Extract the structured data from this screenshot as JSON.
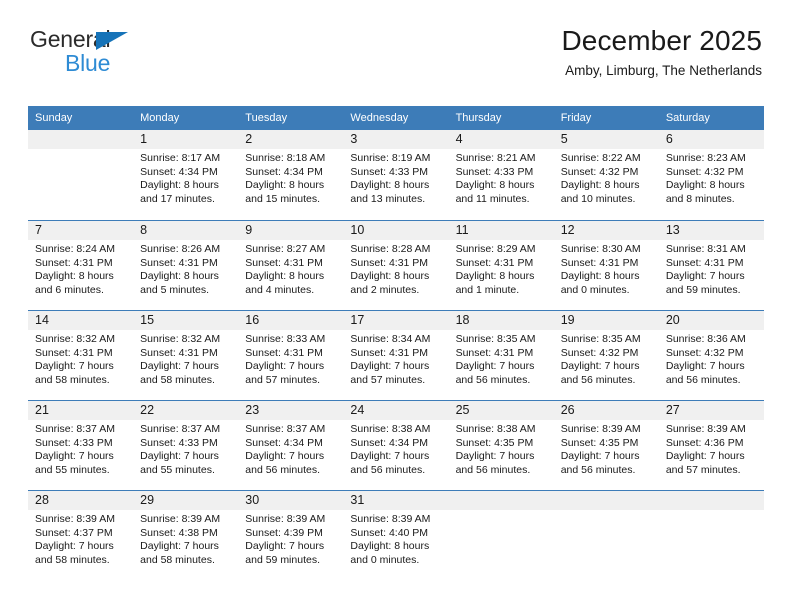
{
  "brand": {
    "line1": "General",
    "line2": "Blue",
    "triangle_icon": "triangle-icon",
    "color_dark": "#2b2b2b",
    "color_blue": "#2e8bd4",
    "color_triangle": "#1673b8"
  },
  "header": {
    "title": "December 2025",
    "subtitle": "Amby, Limburg, The Netherlands"
  },
  "theme": {
    "header_blue": "#3d7cb8",
    "row_divider": "#3d7cb8",
    "day_band": "#f0f0f0",
    "text": "#1a1a1a"
  },
  "weekdays": [
    "Sunday",
    "Monday",
    "Tuesday",
    "Wednesday",
    "Thursday",
    "Friday",
    "Saturday"
  ],
  "weeks": [
    [
      {
        "day": "",
        "empty": true,
        "sunrise": "",
        "sunset": "",
        "daylight1": "",
        "daylight2": ""
      },
      {
        "day": "1",
        "empty": false,
        "sunrise": "Sunrise: 8:17 AM",
        "sunset": "Sunset: 4:34 PM",
        "daylight1": "Daylight: 8 hours",
        "daylight2": "and 17 minutes."
      },
      {
        "day": "2",
        "empty": false,
        "sunrise": "Sunrise: 8:18 AM",
        "sunset": "Sunset: 4:34 PM",
        "daylight1": "Daylight: 8 hours",
        "daylight2": "and 15 minutes."
      },
      {
        "day": "3",
        "empty": false,
        "sunrise": "Sunrise: 8:19 AM",
        "sunset": "Sunset: 4:33 PM",
        "daylight1": "Daylight: 8 hours",
        "daylight2": "and 13 minutes."
      },
      {
        "day": "4",
        "empty": false,
        "sunrise": "Sunrise: 8:21 AM",
        "sunset": "Sunset: 4:33 PM",
        "daylight1": "Daylight: 8 hours",
        "daylight2": "and 11 minutes."
      },
      {
        "day": "5",
        "empty": false,
        "sunrise": "Sunrise: 8:22 AM",
        "sunset": "Sunset: 4:32 PM",
        "daylight1": "Daylight: 8 hours",
        "daylight2": "and 10 minutes."
      },
      {
        "day": "6",
        "empty": false,
        "sunrise": "Sunrise: 8:23 AM",
        "sunset": "Sunset: 4:32 PM",
        "daylight1": "Daylight: 8 hours",
        "daylight2": "and 8 minutes."
      }
    ],
    [
      {
        "day": "7",
        "empty": false,
        "sunrise": "Sunrise: 8:24 AM",
        "sunset": "Sunset: 4:31 PM",
        "daylight1": "Daylight: 8 hours",
        "daylight2": "and 6 minutes."
      },
      {
        "day": "8",
        "empty": false,
        "sunrise": "Sunrise: 8:26 AM",
        "sunset": "Sunset: 4:31 PM",
        "daylight1": "Daylight: 8 hours",
        "daylight2": "and 5 minutes."
      },
      {
        "day": "9",
        "empty": false,
        "sunrise": "Sunrise: 8:27 AM",
        "sunset": "Sunset: 4:31 PM",
        "daylight1": "Daylight: 8 hours",
        "daylight2": "and 4 minutes."
      },
      {
        "day": "10",
        "empty": false,
        "sunrise": "Sunrise: 8:28 AM",
        "sunset": "Sunset: 4:31 PM",
        "daylight1": "Daylight: 8 hours",
        "daylight2": "and 2 minutes."
      },
      {
        "day": "11",
        "empty": false,
        "sunrise": "Sunrise: 8:29 AM",
        "sunset": "Sunset: 4:31 PM",
        "daylight1": "Daylight: 8 hours",
        "daylight2": "and 1 minute."
      },
      {
        "day": "12",
        "empty": false,
        "sunrise": "Sunrise: 8:30 AM",
        "sunset": "Sunset: 4:31 PM",
        "daylight1": "Daylight: 8 hours",
        "daylight2": "and 0 minutes."
      },
      {
        "day": "13",
        "empty": false,
        "sunrise": "Sunrise: 8:31 AM",
        "sunset": "Sunset: 4:31 PM",
        "daylight1": "Daylight: 7 hours",
        "daylight2": "and 59 minutes."
      }
    ],
    [
      {
        "day": "14",
        "empty": false,
        "sunrise": "Sunrise: 8:32 AM",
        "sunset": "Sunset: 4:31 PM",
        "daylight1": "Daylight: 7 hours",
        "daylight2": "and 58 minutes."
      },
      {
        "day": "15",
        "empty": false,
        "sunrise": "Sunrise: 8:32 AM",
        "sunset": "Sunset: 4:31 PM",
        "daylight1": "Daylight: 7 hours",
        "daylight2": "and 58 minutes."
      },
      {
        "day": "16",
        "empty": false,
        "sunrise": "Sunrise: 8:33 AM",
        "sunset": "Sunset: 4:31 PM",
        "daylight1": "Daylight: 7 hours",
        "daylight2": "and 57 minutes."
      },
      {
        "day": "17",
        "empty": false,
        "sunrise": "Sunrise: 8:34 AM",
        "sunset": "Sunset: 4:31 PM",
        "daylight1": "Daylight: 7 hours",
        "daylight2": "and 57 minutes."
      },
      {
        "day": "18",
        "empty": false,
        "sunrise": "Sunrise: 8:35 AM",
        "sunset": "Sunset: 4:31 PM",
        "daylight1": "Daylight: 7 hours",
        "daylight2": "and 56 minutes."
      },
      {
        "day": "19",
        "empty": false,
        "sunrise": "Sunrise: 8:35 AM",
        "sunset": "Sunset: 4:32 PM",
        "daylight1": "Daylight: 7 hours",
        "daylight2": "and 56 minutes."
      },
      {
        "day": "20",
        "empty": false,
        "sunrise": "Sunrise: 8:36 AM",
        "sunset": "Sunset: 4:32 PM",
        "daylight1": "Daylight: 7 hours",
        "daylight2": "and 56 minutes."
      }
    ],
    [
      {
        "day": "21",
        "empty": false,
        "sunrise": "Sunrise: 8:37 AM",
        "sunset": "Sunset: 4:33 PM",
        "daylight1": "Daylight: 7 hours",
        "daylight2": "and 55 minutes."
      },
      {
        "day": "22",
        "empty": false,
        "sunrise": "Sunrise: 8:37 AM",
        "sunset": "Sunset: 4:33 PM",
        "daylight1": "Daylight: 7 hours",
        "daylight2": "and 55 minutes."
      },
      {
        "day": "23",
        "empty": false,
        "sunrise": "Sunrise: 8:37 AM",
        "sunset": "Sunset: 4:34 PM",
        "daylight1": "Daylight: 7 hours",
        "daylight2": "and 56 minutes."
      },
      {
        "day": "24",
        "empty": false,
        "sunrise": "Sunrise: 8:38 AM",
        "sunset": "Sunset: 4:34 PM",
        "daylight1": "Daylight: 7 hours",
        "daylight2": "and 56 minutes."
      },
      {
        "day": "25",
        "empty": false,
        "sunrise": "Sunrise: 8:38 AM",
        "sunset": "Sunset: 4:35 PM",
        "daylight1": "Daylight: 7 hours",
        "daylight2": "and 56 minutes."
      },
      {
        "day": "26",
        "empty": false,
        "sunrise": "Sunrise: 8:39 AM",
        "sunset": "Sunset: 4:35 PM",
        "daylight1": "Daylight: 7 hours",
        "daylight2": "and 56 minutes."
      },
      {
        "day": "27",
        "empty": false,
        "sunrise": "Sunrise: 8:39 AM",
        "sunset": "Sunset: 4:36 PM",
        "daylight1": "Daylight: 7 hours",
        "daylight2": "and 57 minutes."
      }
    ],
    [
      {
        "day": "28",
        "empty": false,
        "sunrise": "Sunrise: 8:39 AM",
        "sunset": "Sunset: 4:37 PM",
        "daylight1": "Daylight: 7 hours",
        "daylight2": "and 58 minutes."
      },
      {
        "day": "29",
        "empty": false,
        "sunrise": "Sunrise: 8:39 AM",
        "sunset": "Sunset: 4:38 PM",
        "daylight1": "Daylight: 7 hours",
        "daylight2": "and 58 minutes."
      },
      {
        "day": "30",
        "empty": false,
        "sunrise": "Sunrise: 8:39 AM",
        "sunset": "Sunset: 4:39 PM",
        "daylight1": "Daylight: 7 hours",
        "daylight2": "and 59 minutes."
      },
      {
        "day": "31",
        "empty": false,
        "sunrise": "Sunrise: 8:39 AM",
        "sunset": "Sunset: 4:40 PM",
        "daylight1": "Daylight: 8 hours",
        "daylight2": "and 0 minutes."
      },
      {
        "day": "",
        "empty": true,
        "sunrise": "",
        "sunset": "",
        "daylight1": "",
        "daylight2": ""
      },
      {
        "day": "",
        "empty": true,
        "sunrise": "",
        "sunset": "",
        "daylight1": "",
        "daylight2": ""
      },
      {
        "day": "",
        "empty": true,
        "sunrise": "",
        "sunset": "",
        "daylight1": "",
        "daylight2": ""
      }
    ]
  ]
}
